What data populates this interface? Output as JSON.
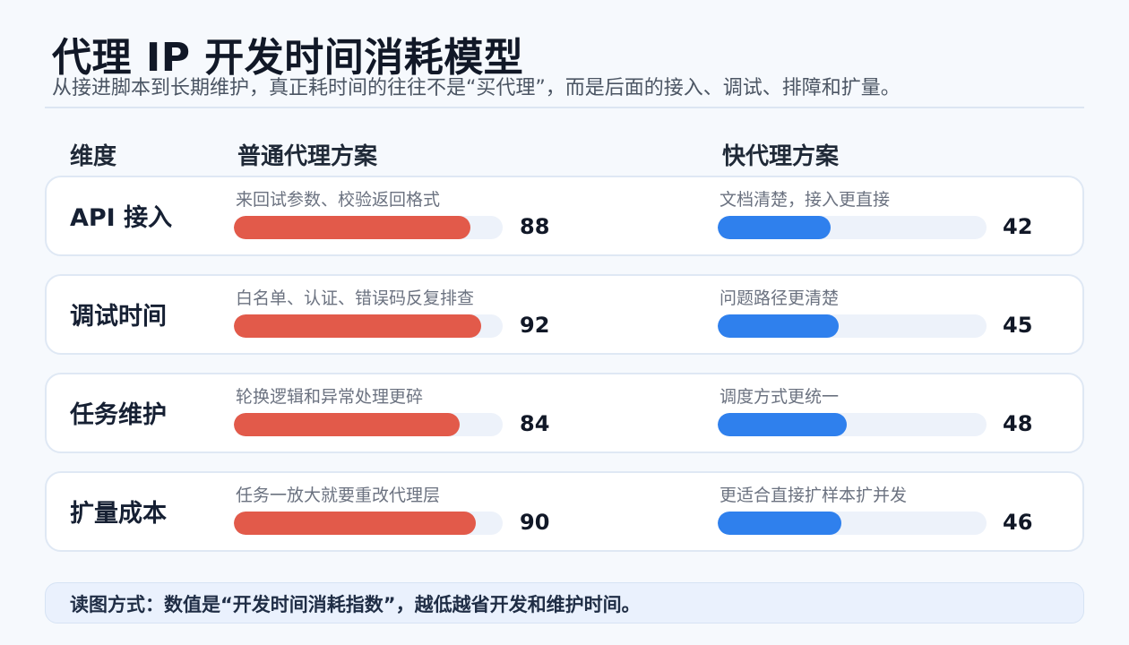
{
  "header": {
    "title": "代理 IP 开发时间消耗模型",
    "subtitle": "从接进脚本到长期维护，真正耗时间的往往不是“买代理”，而是后面的接入、调试、排障和扩量。"
  },
  "columns": {
    "dimension": "维度",
    "normal": "普通代理方案",
    "fast": "快代理方案"
  },
  "colors": {
    "normal": "#e25a4a",
    "fast": "#2f80ed",
    "track": "#edf2fa"
  },
  "chart_data": {
    "type": "bar",
    "categories": [
      "API 接入",
      "调试时间",
      "任务维护",
      "扩量成本"
    ],
    "xlim": [
      0,
      100
    ],
    "series": [
      {
        "name": "普通代理方案",
        "values": [
          88,
          92,
          84,
          90
        ],
        "notes": [
          "来回试参数、校验返回格式",
          "白名单、认证、错误码反复排查",
          "轮换逻辑和异常处理更碎",
          "任务一放大就要重改代理层"
        ]
      },
      {
        "name": "快代理方案",
        "values": [
          42,
          45,
          48,
          46
        ],
        "notes": [
          "文档清楚，接入更直接",
          "问题路径更清楚",
          "调度方式更统一",
          "更适合直接扩样本扩并发"
        ]
      }
    ]
  },
  "footer": {
    "text": "读图方式：数值是“开发时间消耗指数”，越低越省开发和维护时间。"
  }
}
